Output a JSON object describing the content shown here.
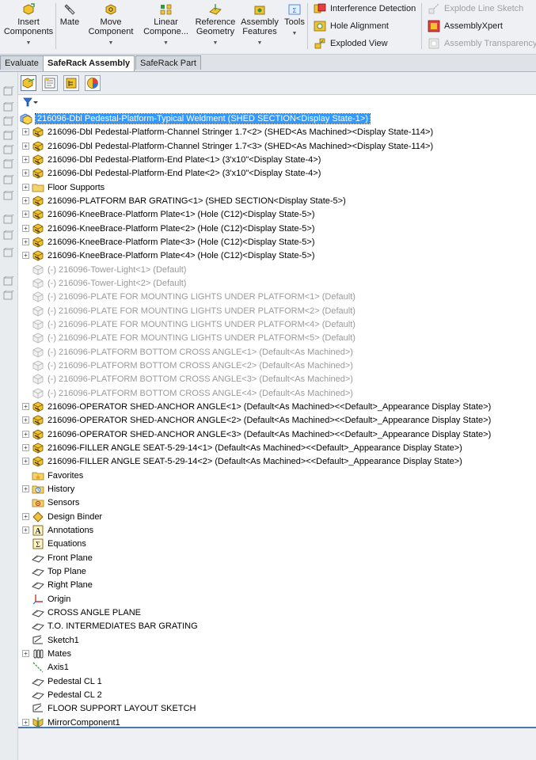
{
  "ribbon": {
    "big_buttons": [
      {
        "label": "Insert\nComponents",
        "icon": "insert-components-icon"
      },
      {
        "label": "Mate",
        "icon": "mate-icon"
      },
      {
        "label": "Move\nComponent",
        "icon": "move-component-icon"
      },
      {
        "label": "Linear\nCompone...",
        "icon": "linear-pattern-icon"
      },
      {
        "label": "Reference\nGeometry",
        "icon": "reference-geometry-icon"
      },
      {
        "label": "Assembly\nFeatures",
        "icon": "assembly-features-icon"
      },
      {
        "label": "Tools",
        "icon": "tools-icon"
      }
    ],
    "small_buttons": [
      {
        "label": "Interference Detection",
        "icon": "interference-detection-icon",
        "enabled": true
      },
      {
        "label": "Hole Alignment",
        "icon": "hole-alignment-icon",
        "enabled": true
      },
      {
        "label": "Exploded View",
        "icon": "exploded-view-icon",
        "enabled": true
      },
      {
        "label": "Explode Line Sketch",
        "icon": "explode-line-sketch-icon",
        "enabled": false
      },
      {
        "label": "AssemblyXpert",
        "icon": "assemblyxpert-icon",
        "enabled": true
      },
      {
        "label": "Assembly Transparency",
        "icon": "assembly-transparency-icon",
        "enabled": false
      }
    ]
  },
  "tabs": [
    {
      "label": "Evaluate",
      "active": false
    },
    {
      "label": "SafeRack Assembly",
      "active": true
    },
    {
      "label": "SafeRack Part",
      "active": false
    }
  ],
  "featuremanager": {
    "panel_tabs": [
      "featuremanager-tab",
      "propertymanager-tab",
      "configurationmanager-tab",
      "display-manager-tab"
    ],
    "filter_icon": "filter-icon",
    "tree": [
      {
        "label": "216096-Dbl Pedestal-Platform-Typical Weldment  (SHED SECTION<Display State-1>)",
        "icon": "assembly-icon",
        "kind": "root",
        "expander": false
      },
      {
        "label": "216096-Dbl Pedestal-Platform-Channel Stringer 1.7<2> (SHED<As Machined><Display State-114>)",
        "icon": "part-icon",
        "kind": "part",
        "expander": true
      },
      {
        "label": "216096-Dbl Pedestal-Platform-Channel Stringer 1.7<3> (SHED<As Machined><Display State-114>)",
        "icon": "part-icon",
        "kind": "part",
        "expander": true
      },
      {
        "label": "216096-Dbl Pedestal-Platform-End Plate<1> (3'x10\"<Display State-4>)",
        "icon": "part-icon",
        "kind": "part",
        "expander": true
      },
      {
        "label": "216096-Dbl Pedestal-Platform-End Plate<2> (3'x10\"<Display State-4>)",
        "icon": "part-icon",
        "kind": "part",
        "expander": true
      },
      {
        "label": "Floor Supports",
        "icon": "folder-icon",
        "kind": "folder",
        "expander": true
      },
      {
        "label": "216096-PLATFORM BAR GRATING<1> (SHED SECTION<Display State-5>)",
        "icon": "part-icon",
        "kind": "part",
        "expander": true
      },
      {
        "label": "216096-KneeBrace-Platform Plate<1> (Hole (C12)<Display State-5>)",
        "icon": "part-icon",
        "kind": "part",
        "expander": true
      },
      {
        "label": "216096-KneeBrace-Platform Plate<2> (Hole (C12)<Display State-5>)",
        "icon": "part-icon",
        "kind": "part",
        "expander": true
      },
      {
        "label": "216096-KneeBrace-Platform Plate<3> (Hole (C12)<Display State-5>)",
        "icon": "part-icon",
        "kind": "part",
        "expander": true
      },
      {
        "label": "216096-KneeBrace-Platform Plate<4> (Hole (C12)<Display State-5>)",
        "icon": "part-icon",
        "kind": "part",
        "expander": true
      },
      {
        "label": "(-) 216096-Tower-Light<1> (Default)",
        "icon": "part-suppressed-icon",
        "kind": "suppressed",
        "expander": false
      },
      {
        "label": "(-) 216096-Tower-Light<2> (Default)",
        "icon": "part-suppressed-icon",
        "kind": "suppressed",
        "expander": false
      },
      {
        "label": "(-) 216096-PLATE FOR MOUNTING LIGHTS UNDER PLATFORM<1> (Default)",
        "icon": "part-suppressed-icon",
        "kind": "suppressed",
        "expander": false
      },
      {
        "label": "(-) 216096-PLATE FOR MOUNTING LIGHTS UNDER PLATFORM<2> (Default)",
        "icon": "part-suppressed-icon",
        "kind": "suppressed",
        "expander": false
      },
      {
        "label": "(-) 216096-PLATE FOR MOUNTING LIGHTS UNDER PLATFORM<4> (Default)",
        "icon": "part-suppressed-icon",
        "kind": "suppressed",
        "expander": false
      },
      {
        "label": "(-) 216096-PLATE FOR MOUNTING LIGHTS UNDER PLATFORM<5> (Default)",
        "icon": "part-suppressed-icon",
        "kind": "suppressed",
        "expander": false
      },
      {
        "label": "(-) 216096-PLATFORM BOTTOM CROSS ANGLE<1> (Default<As Machined>)",
        "icon": "part-suppressed-icon",
        "kind": "suppressed",
        "expander": false
      },
      {
        "label": "(-) 216096-PLATFORM BOTTOM CROSS ANGLE<2> (Default<As Machined>)",
        "icon": "part-suppressed-icon",
        "kind": "suppressed",
        "expander": false
      },
      {
        "label": "(-) 216096-PLATFORM BOTTOM CROSS ANGLE<3> (Default<As Machined>)",
        "icon": "part-suppressed-icon",
        "kind": "suppressed",
        "expander": false
      },
      {
        "label": "(-) 216096-PLATFORM BOTTOM CROSS ANGLE<4> (Default<As Machined>)",
        "icon": "part-suppressed-icon",
        "kind": "suppressed",
        "expander": false
      },
      {
        "label": "216096-OPERATOR SHED-ANCHOR ANGLE<1> (Default<As Machined><<Default>_Appearance Display State>)",
        "icon": "part-icon",
        "kind": "part",
        "expander": true
      },
      {
        "label": "216096-OPERATOR SHED-ANCHOR ANGLE<2> (Default<As Machined><<Default>_Appearance Display State>)",
        "icon": "part-icon",
        "kind": "part",
        "expander": true
      },
      {
        "label": "216096-OPERATOR SHED-ANCHOR ANGLE<3> (Default<As Machined><<Default>_Appearance Display State>)",
        "icon": "part-icon",
        "kind": "part",
        "expander": true
      },
      {
        "label": "216096-FILLER ANGLE SEAT-5-29-14<1> (Default<As Machined><<Default>_Appearance Display State>)",
        "icon": "part-icon",
        "kind": "part",
        "expander": true
      },
      {
        "label": "216096-FILLER ANGLE SEAT-5-29-14<2> (Default<As Machined><<Default>_Appearance Display State>)",
        "icon": "part-icon",
        "kind": "part",
        "expander": true
      },
      {
        "label": "Favorites",
        "icon": "favorites-folder-icon",
        "kind": "folder",
        "expander": false
      },
      {
        "label": "History",
        "icon": "history-icon",
        "kind": "folder",
        "expander": true
      },
      {
        "label": "Sensors",
        "icon": "sensors-icon",
        "kind": "folder",
        "expander": false
      },
      {
        "label": "Design Binder",
        "icon": "design-binder-icon",
        "kind": "folder",
        "expander": true
      },
      {
        "label": "Annotations",
        "icon": "annotations-icon",
        "kind": "folder",
        "expander": true
      },
      {
        "label": "Equations",
        "icon": "equations-icon",
        "kind": "folder",
        "expander": false
      },
      {
        "label": "Front Plane",
        "icon": "plane-icon",
        "kind": "plane",
        "expander": false
      },
      {
        "label": "Top Plane",
        "icon": "plane-icon",
        "kind": "plane",
        "expander": false
      },
      {
        "label": "Right Plane",
        "icon": "plane-icon",
        "kind": "plane",
        "expander": false
      },
      {
        "label": "Origin",
        "icon": "origin-icon",
        "kind": "origin",
        "expander": false
      },
      {
        "label": "CROSS ANGLE PLANE",
        "icon": "plane-icon",
        "kind": "plane",
        "expander": false
      },
      {
        "label": "T.O. INTERMEDIATES BAR GRATING",
        "icon": "plane-icon",
        "kind": "plane",
        "expander": false
      },
      {
        "label": "Sketch1",
        "icon": "sketch-icon",
        "kind": "sketch",
        "expander": false
      },
      {
        "label": "Mates",
        "icon": "mates-icon",
        "kind": "folder",
        "expander": true
      },
      {
        "label": "Axis1",
        "icon": "axis-icon",
        "kind": "axis",
        "expander": false
      },
      {
        "label": "Pedestal CL 1",
        "icon": "plane-icon",
        "kind": "plane",
        "expander": false
      },
      {
        "label": "Pedestal CL 2",
        "icon": "plane-icon",
        "kind": "plane",
        "expander": false
      },
      {
        "label": "FLOOR SUPPORT LAYOUT SKETCH",
        "icon": "sketch-icon",
        "kind": "sketch",
        "expander": false
      },
      {
        "label": "MirrorComponent1",
        "icon": "mirror-component-icon",
        "kind": "feature",
        "expander": true
      }
    ]
  },
  "colors": {
    "selection": "#3399ff",
    "suppressed_text": "#9a9a9a",
    "part_yellow": "#f2c230",
    "assembly_blue": "#2f6fd6"
  }
}
